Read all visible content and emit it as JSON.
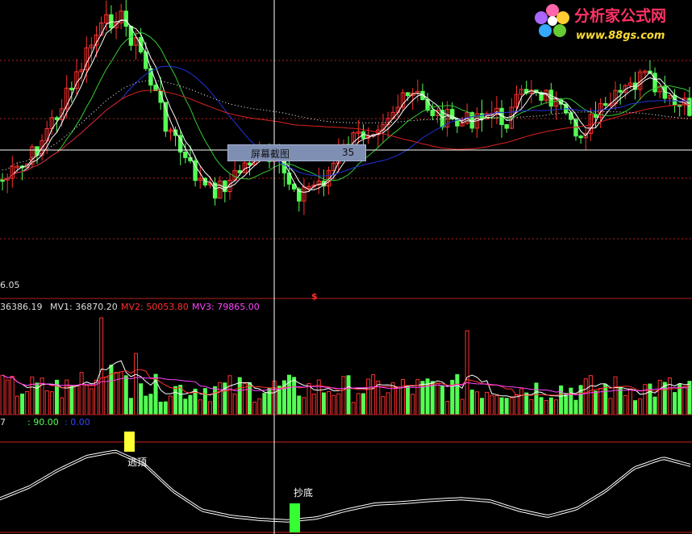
{
  "logo": {
    "text": "分析家公式网",
    "url": "www.88gs.com"
  },
  "tooltip": {
    "label": "屏幕截图",
    "value": "35"
  },
  "price_panel": {
    "axis_label": "6.05",
    "marker": "$"
  },
  "volume_panel": {
    "vol_value": "36386.19",
    "mv1_label": "MV1: 36870.20",
    "mv2_label": "MV2: 50053.80",
    "mv3_label": "MV3: 79865.00"
  },
  "indicator_panel": {
    "prefix": "7",
    "level_hi": ": 90.00",
    "level_lo": ": 0.00",
    "signal_top": "逃顶",
    "signal_bottom": "抄底"
  },
  "colors": {
    "up": "#ff3030",
    "down": "#54ff54",
    "ma_white": "#ffffff",
    "ma_green": "#33cc33",
    "ma_blue": "#2233dd",
    "ma_red": "#dd2222",
    "mv2": "#ff3030",
    "mv3": "#ff44ff",
    "signal_top": "#ffff33",
    "signal_bottom": "#33ff33"
  },
  "chart_data": {
    "type": "candlestick",
    "panels": [
      "price",
      "volume",
      "indicator"
    ],
    "price_shape": [
      0.35,
      0.4,
      0.55,
      0.7,
      0.9,
      1.0,
      0.85,
      0.6,
      0.42,
      0.3,
      0.35,
      0.45,
      0.4,
      0.3,
      0.35,
      0.48,
      0.55,
      0.62,
      0.68,
      0.6,
      0.56,
      0.62,
      0.58,
      0.72,
      0.66,
      0.52,
      0.6,
      0.68,
      0.75,
      0.65,
      0.62
    ],
    "indicator_shape": [
      0.35,
      0.5,
      0.72,
      0.9,
      0.97,
      0.8,
      0.45,
      0.2,
      0.12,
      0.08,
      0.06,
      0.1,
      0.2,
      0.28,
      0.3,
      0.33,
      0.35,
      0.32,
      0.2,
      0.12,
      0.22,
      0.45,
      0.75,
      0.88,
      0.78
    ],
    "signals": [
      {
        "label": "逃顶",
        "type": "top"
      },
      {
        "label": "抄底",
        "type": "bottom"
      }
    ]
  }
}
